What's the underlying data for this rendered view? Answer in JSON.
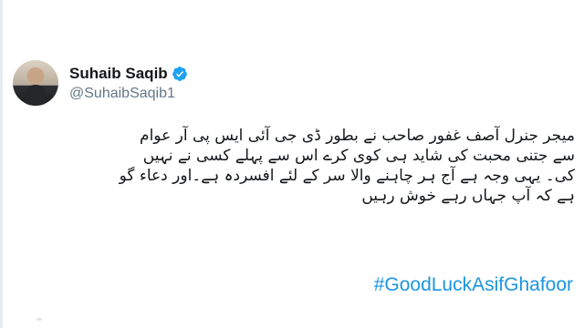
{
  "author": {
    "display_name": "Suhaib Saqib",
    "handle": "@SuhaibSaqib1",
    "verified": true,
    "avatar_icon": "profile-photo"
  },
  "tweet": {
    "lines": [
      "میجر جنرل آصف غفور صاحب نے بطور ڈی جی آئی ایس پی آر عوام",
      "سے جتنی محبت کی شاید ہی کوی کرے اس سے پہلے کسی نے نہیں",
      "کی۔ یہی وجہ ہے آج ہر چاہنے والا سر کے لئے افسردہ ہے۔اور دعاء گو",
      "ہے کہ آپ جہاں رہے خوش رہیں"
    ],
    "hashtag": "#GoodLuckAsifGhafoor"
  },
  "colors": {
    "link": "#1b95e0",
    "text": "#14171a",
    "secondary": "#657786",
    "verified_badge": "#1da1f2"
  }
}
